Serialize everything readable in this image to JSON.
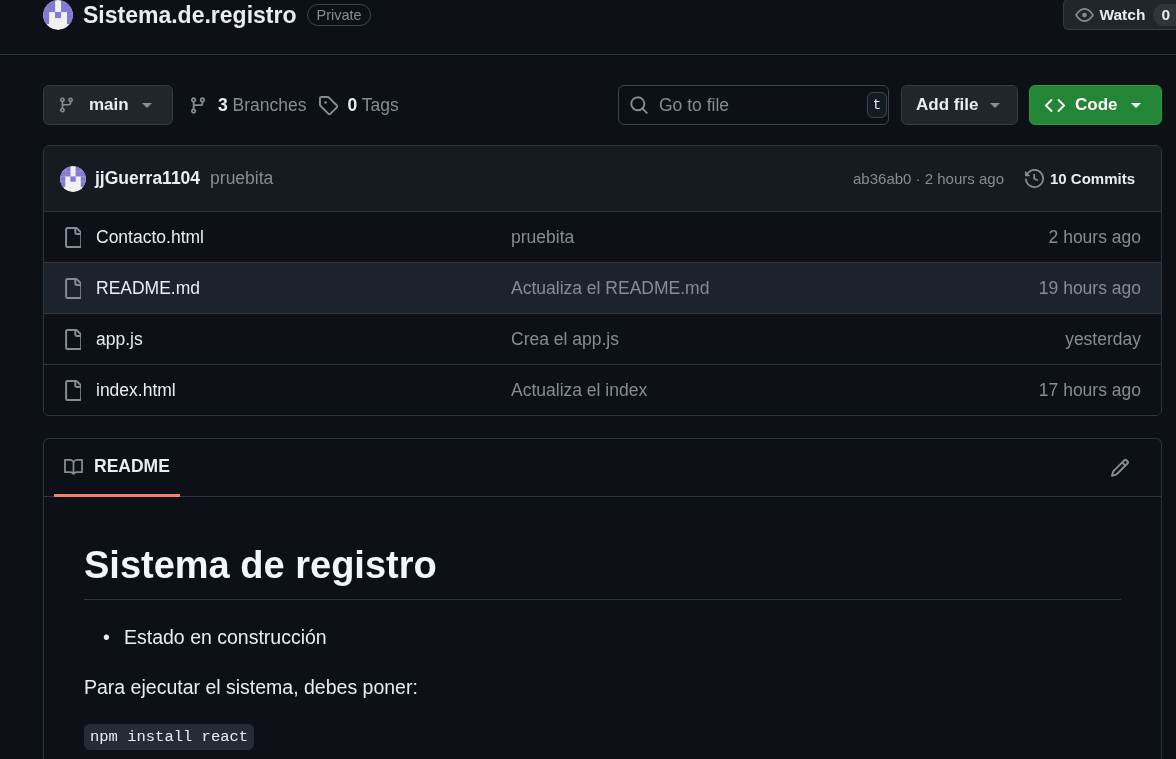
{
  "repo": {
    "name": "Sistema.de.registro",
    "visibility": "Private",
    "watch": {
      "label": "Watch",
      "count": "0"
    }
  },
  "toolbar": {
    "branch": "main",
    "branches": {
      "count": "3",
      "label": "Branches"
    },
    "tags": {
      "count": "0",
      "label": "Tags"
    },
    "search": {
      "placeholder": "Go to file",
      "shortcut": "t"
    },
    "add_file": "Add file",
    "code": "Code"
  },
  "latest_commit": {
    "author": "jjGuerra1104",
    "message": "pruebita",
    "hash_and_time": "ab36ab0 · 2 hours ago",
    "commits": {
      "count": "10",
      "label": "Commits"
    }
  },
  "files": [
    {
      "name": "Contacto.html",
      "message": "pruebita",
      "time": "2 hours ago",
      "hovered": false
    },
    {
      "name": "README.md",
      "message": "Actualiza el README.md",
      "time": "19 hours ago",
      "hovered": true
    },
    {
      "name": "app.js",
      "message": "Crea el app.js",
      "time": "yesterday",
      "hovered": false
    },
    {
      "name": "index.html",
      "message": "Actualiza el index",
      "time": "17 hours ago",
      "hovered": false
    }
  ],
  "readme": {
    "tab": {
      "label": "README",
      "selected": true
    },
    "heading": "Sistema de registro",
    "list": [
      {
        "marker": "•",
        "text": "Estado en construcción"
      }
    ],
    "paragraph": "Para ejecutar el sistema, debes poner:",
    "code": "npm install react"
  }
}
